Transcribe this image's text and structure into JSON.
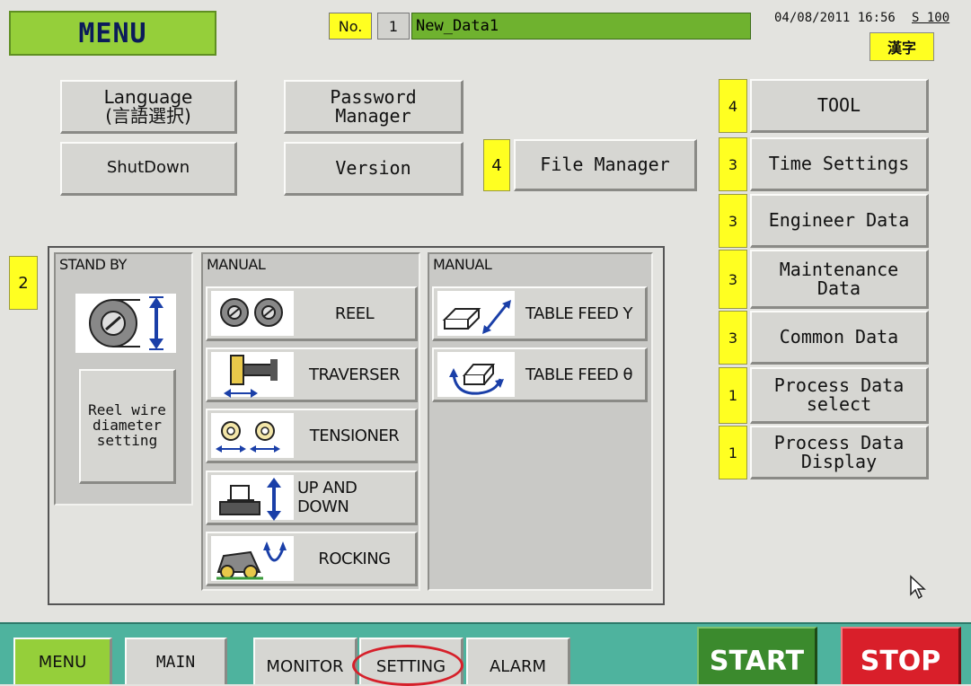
{
  "header": {
    "menu_title": "MENU",
    "no_label": "No.",
    "no_value": "1",
    "data_name": "New_Data1",
    "datetime": "04/08/2011 16:56",
    "status_code": "S 100",
    "kanji_label": "漢字"
  },
  "top_buttons": {
    "language": "Language\n(言語選択)",
    "password_manager": "Password\nManager",
    "shutdown": "ShutDown",
    "version": "Version",
    "file_manager": "File Manager",
    "file_manager_level": "4"
  },
  "right_buttons": [
    {
      "level": "4",
      "label": "TOOL"
    },
    {
      "level": "3",
      "label": "Time Settings"
    },
    {
      "level": "3",
      "label": "Engineer Data"
    },
    {
      "level": "3",
      "label": "Maintenance\nData"
    },
    {
      "level": "3",
      "label": "Common Data"
    },
    {
      "level": "1",
      "label": "Process Data\nselect"
    },
    {
      "level": "1",
      "label": "Process Data\nDisplay"
    }
  ],
  "manual_section": {
    "level": "2",
    "standby_title": "STAND BY",
    "reel_wire_button": "Reel wire\ndiameter\nsetting",
    "manual_title_1": "MANUAL",
    "manual_title_2": "MANUAL",
    "items_left": [
      "REEL",
      "TRAVERSER",
      "TENSIONER",
      "UP AND DOWN",
      "ROCKING"
    ],
    "items_right": [
      "TABLE FEED Y",
      "TABLE FEED θ"
    ]
  },
  "bottom_nav": {
    "menu": "MENU",
    "main": "MAIN",
    "monitor": "MONITOR",
    "setting": "SETTING",
    "alarm": "ALARM",
    "start": "START",
    "stop": "STOP"
  },
  "colors": {
    "menu_green": "#95cf3a",
    "data_green": "#6fb22f",
    "badge_yellow": "#ffff21",
    "nav_bar": "#4eb39e",
    "start_green": "#3b8a2d",
    "stop_red": "#d91f2a",
    "highlight_ring": "#d6202a"
  }
}
